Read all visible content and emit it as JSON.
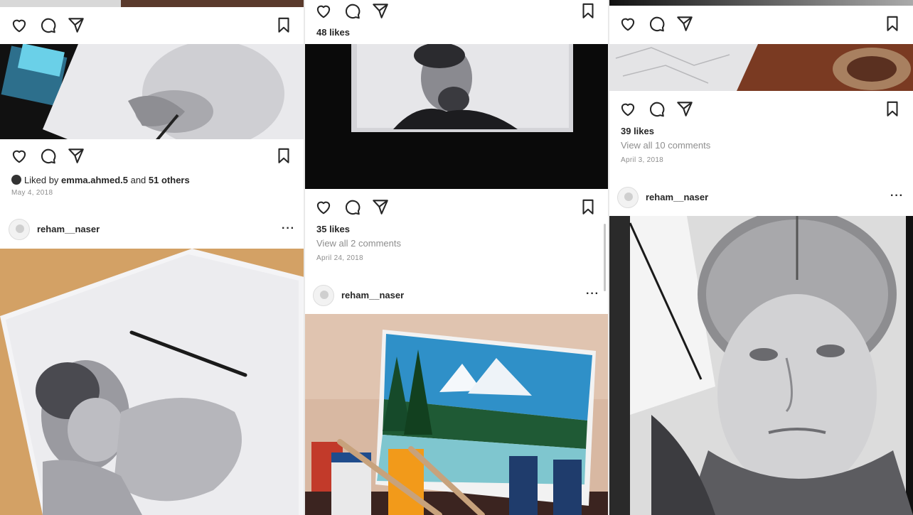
{
  "col1": {
    "post_b": {
      "liked_by_prefix": "Liked by ",
      "liked_by_user": "emma.ahmed.5",
      "liked_by_mid": " and ",
      "liked_by_others": "51 others",
      "date": "May 4, 2018"
    },
    "post_c": {
      "username": "reham__naser",
      "more": "···"
    }
  },
  "col2": {
    "post_a": {
      "likes": "48 likes"
    },
    "post_b": {
      "likes": "35 likes",
      "comments": "View all 2 comments",
      "date": "April 24, 2018"
    },
    "post_c": {
      "username": "reham__naser",
      "more": "···"
    }
  },
  "col3": {
    "post_b": {
      "likes": "39 likes",
      "comments": "View all 10 comments",
      "date": "April 3, 2018"
    },
    "post_c": {
      "username": "reham__naser",
      "more": "···"
    }
  },
  "icons": [
    "heart-icon",
    "comment-icon",
    "share-icon",
    "bookmark-icon"
  ]
}
